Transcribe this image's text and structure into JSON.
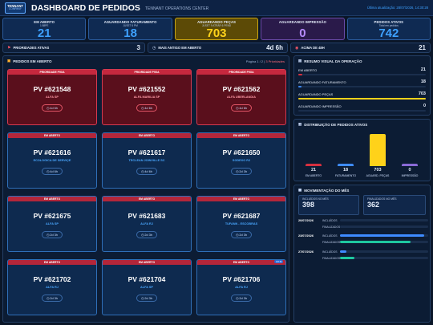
{
  "header": {
    "logo_line1": "TENNANT",
    "logo_line2": "COMPANY",
    "title": "DASHBOARD DE PEDIDOS",
    "subtitle": "TENNANT OPERATIONS CENTER",
    "updated": "Última atualização: 28/07/2026, 14:30:28"
  },
  "kpis": [
    {
      "title": "EM ABERTO",
      "sub": "1 88PE",
      "value": "21",
      "style": "blue"
    },
    {
      "title": "AGUARDANDO FATURAMENTO",
      "sub": "JUSET 6 PM",
      "value": "18",
      "style": "blue"
    },
    {
      "title": "AGUARDANDO PEÇAS",
      "sub": "JUSET 9 ATRÁR 6 PEND",
      "value": "703",
      "style": "yellow"
    },
    {
      "title": "AGUARDANDO IMPRESSÃO",
      "sub": "",
      "value": "0",
      "style": "purple"
    },
    {
      "title": "PEDIDOS ATIVOS",
      "sub": "Total em pedidos",
      "value": "742",
      "style": "blue"
    }
  ],
  "stats": {
    "priorities_label": "PRIORIDADES ATIVAS",
    "priorities_value": "3",
    "oldest_label": "MAIS ANTIGO EM ABERTO",
    "oldest_value": "4d 6h",
    "over48_label": "ACIMA DE 48H",
    "over48_value": "21"
  },
  "orders": {
    "title": "PEDIDOS EM ABERTO",
    "page_prefix": "Página 1 / 2",
    "page_pri": "3 Prioridades",
    "cards": [
      {
        "band": "PRIORIDADE P9XA",
        "pv": "PV #621548",
        "client": "ALFA SP",
        "time": "◷ 4d 6h",
        "kind": "pri"
      },
      {
        "band": "PRIORIDADE P9XA",
        "pv": "PV #621552",
        "client": "ALFA MARILIA SP",
        "time": "◷ 4d 6h",
        "kind": "pri"
      },
      {
        "band": "PRIORIDADE P9XA",
        "pv": "PV #621562",
        "client": "ALFA UBERLANDIA",
        "time": "◷ 4d 6h",
        "kind": "pri"
      },
      {
        "band": "EM ABERTO",
        "pv": "PV #621616",
        "client": "ECOLOGICA DE SERVIÇE",
        "time": "◷ 4d 6h",
        "kind": "norm"
      },
      {
        "band": "EM ABERTO",
        "pv": "PV #621617",
        "client": "TECLEAN JOINVILLE SC",
        "time": "◷ 4d 6h",
        "kind": "norm"
      },
      {
        "band": "EM ABERTO",
        "pv": "PV #621650",
        "client": "SODEXO RJ",
        "time": "◷ 2d 3h",
        "kind": "norm"
      },
      {
        "band": "EM ABERTO",
        "pv": "PV #621675",
        "client": "ALFA SP",
        "time": "◷ 2d 3h",
        "kind": "norm"
      },
      {
        "band": "EM ABERTO",
        "pv": "PV #621683",
        "client": "ALFA RJ",
        "time": "◷ 2d 3h",
        "kind": "norm"
      },
      {
        "band": "EM ABERTO",
        "pv": "PV #621687",
        "client": "TUFANN - ESCOBRAS",
        "time": "◷ 2d 3h",
        "kind": "norm"
      },
      {
        "band": "EM ABERTO",
        "pv": "PV #621702",
        "client": "ALFA RJ",
        "time": "◷ 2d 3h",
        "kind": "norm"
      },
      {
        "band": "EM ABERTO",
        "pv": "PV #621704",
        "client": "ALFA SP",
        "time": "◷ 2d 3h",
        "kind": "norm"
      },
      {
        "band": "EM ABERTO",
        "pv": "PV #621706",
        "client": "ALFA RJ",
        "time": "◷ 2d 3h",
        "kind": "norm"
      }
    ]
  },
  "summary": {
    "title": "RESUMO VISUAL DA OPERAÇÃO",
    "rows": [
      {
        "label": "EM ABERTO",
        "value": "21",
        "fill": 0.03,
        "color": "#d6303f"
      },
      {
        "label": "AGUARDANDO FATURAMENTO",
        "value": "18",
        "fill": 0.025,
        "color": "#3e8bff"
      },
      {
        "label": "AGUARDANDO PEÇAS",
        "value": "703",
        "fill": 1.0,
        "color": "#ffd21a"
      },
      {
        "label": "AGUARDANDO IMPRESSÃO",
        "value": "0",
        "fill": 0.0,
        "color": "#8a6ad6"
      }
    ]
  },
  "distribution": {
    "title": "DISTRIBUIÇÃO DE PEDIDOS ATIVOS",
    "chart_data": {
      "type": "bar",
      "categories": [
        "EM ABERTO",
        "FATURAMENTO",
        "AGUARD. PEÇAS",
        "IMPRESSÃO"
      ],
      "values": [
        21,
        18,
        703,
        0
      ],
      "colors": [
        "#d6303f",
        "#3e8bff",
        "#ffd21a",
        "#8a6ad6"
      ]
    }
  },
  "movement": {
    "title": "MOVIMENTAÇÃO DO MÊS",
    "in_label": "INCLUÍDOS NO MÊS",
    "in_value": "398",
    "out_label": "FINALIZADOS NO MÊS",
    "out_value": "362",
    "today_tag": "HOJE",
    "days": [
      {
        "date": "20/07/2026",
        "in": "0",
        "out": "0",
        "in_fill": 0.0,
        "out_fill": 0.0
      },
      {
        "date": "23/07/2026",
        "in": "373",
        "out": "302",
        "in_fill": 0.95,
        "out_fill": 0.8
      },
      {
        "date": "27/07/2026",
        "in": "25",
        "out": "60",
        "in_fill": 0.07,
        "out_fill": 0.16
      }
    ],
    "row_in": "INCLUÍDOS",
    "row_out": "FINALIZADOS"
  }
}
